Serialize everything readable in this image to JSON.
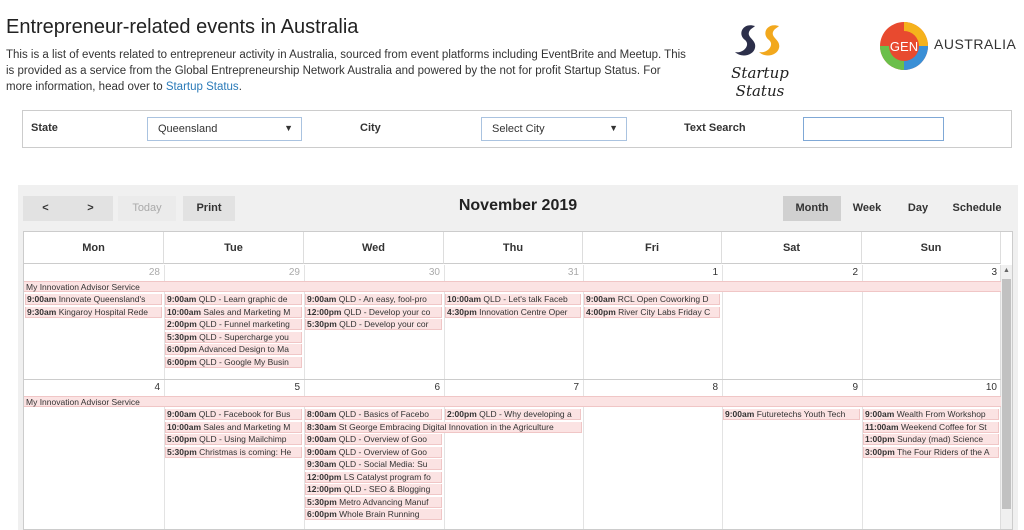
{
  "header": {
    "title": "Entrepreneur-related events in Australia",
    "intro": "This is a list of events related to entrepreneur activity in Australia, sourced from event platforms including EventBrite and Meetup. This is provided as a service from the Global Entrepreneurship Network Australia and powered by the not for profit Startup Status. For more information, head over to ",
    "link": "Startup Status",
    "period": "."
  },
  "logos": {
    "startup_status": "Startup Status",
    "gen_mark": "GEN",
    "gen_country": "AUSTRALIA"
  },
  "filters": {
    "state_label": "State",
    "state_value": "Queensland",
    "city_label": "City",
    "city_value": "Select City",
    "search_label": "Text Search",
    "search_value": ""
  },
  "toolbar": {
    "prev": "<",
    "next": ">",
    "today": "Today",
    "print": "Print",
    "title": "November 2019",
    "views": {
      "month": "Month",
      "week": "Week",
      "day": "Day",
      "schedule": "Schedule"
    },
    "active_view": "month"
  },
  "weekdays": [
    "Mon",
    "Tue",
    "Wed",
    "Thu",
    "Fri",
    "Sat",
    "Sun"
  ],
  "weeks": [
    {
      "days": [
        "28",
        "29",
        "30",
        "31",
        "1",
        "2",
        "3"
      ],
      "other_month": [
        true,
        true,
        true,
        true,
        false,
        false,
        false
      ],
      "allday": "My Innovation Advisor Service",
      "events": [
        [
          {
            "t": "9:00am",
            "n": "Innovate Queensland's"
          },
          {
            "t": "9:30am",
            "n": "Kingaroy Hospital Rede"
          }
        ],
        [
          {
            "t": "9:00am",
            "n": "QLD - Learn graphic de"
          },
          {
            "t": "10:00am",
            "n": "Sales and Marketing M"
          },
          {
            "t": "2:00pm",
            "n": "QLD - Funnel marketing"
          },
          {
            "t": "5:30pm",
            "n": "QLD - Supercharge you"
          },
          {
            "t": "6:00pm",
            "n": "Advanced Design to Ma"
          },
          {
            "t": "6:00pm",
            "n": "QLD - Google My Busin"
          }
        ],
        [
          {
            "t": "9:00am",
            "n": "QLD - An easy, fool-pro"
          },
          {
            "t": "12:00pm",
            "n": "QLD - Develop your co"
          },
          {
            "t": "5:30pm",
            "n": "QLD - Develop your cor"
          }
        ],
        [
          {
            "t": "10:00am",
            "n": "QLD - Let's talk Faceb"
          },
          {
            "t": "4:30pm",
            "n": "Innovation Centre Oper"
          }
        ],
        [
          {
            "t": "9:00am",
            "n": "RCL Open Coworking D"
          },
          {
            "t": "4:00pm",
            "n": "River City Labs Friday C"
          }
        ],
        [],
        []
      ]
    },
    {
      "days": [
        "4",
        "5",
        "6",
        "7",
        "8",
        "9",
        "10"
      ],
      "other_month": [
        false,
        false,
        false,
        false,
        false,
        false,
        false
      ],
      "allday": "My Innovation Advisor Service",
      "events": [
        [],
        [
          {
            "t": "9:00am",
            "n": "QLD - Facebook for Bus"
          },
          {
            "t": "10:00am",
            "n": "Sales and Marketing M"
          },
          {
            "t": "5:00pm",
            "n": "QLD - Using Mailchimp"
          },
          {
            "t": "5:30pm",
            "n": "Christmas is coming: He"
          }
        ],
        [
          {
            "t": "8:00am",
            "n": "QLD - Basics of Facebo"
          },
          {
            "t": "8:30am",
            "n": "St George Embracing Digital Innovation in the Agriculture"
          },
          {
            "t": "9:00am",
            "n": "QLD - Overview of Goo"
          },
          {
            "t": "9:00am",
            "n": "QLD - Overview of Goo"
          },
          {
            "t": "9:30am",
            "n": "QLD - Social Media: Su"
          },
          {
            "t": "12:00pm",
            "n": "LS Catalyst program fo"
          },
          {
            "t": "12:00pm",
            "n": "QLD - SEO & Blogging"
          },
          {
            "t": "5:30pm",
            "n": "Metro Advancing Manuf"
          },
          {
            "t": "6:00pm",
            "n": "Whole Brain Running"
          }
        ],
        [
          {
            "t": "2:00pm",
            "n": "QLD - Why developing a"
          }
        ],
        [],
        [
          {
            "t": "9:00am",
            "n": "Futuretechs Youth Tech"
          }
        ],
        [
          {
            "t": "9:00am",
            "n": "Wealth From Workshop"
          },
          {
            "t": "11:00am",
            "n": "Weekend Coffee for St"
          },
          {
            "t": "1:00pm",
            "n": "Sunday (mad) Science"
          },
          {
            "t": "3:00pm",
            "n": "The Four Riders of the A"
          }
        ]
      ]
    }
  ]
}
